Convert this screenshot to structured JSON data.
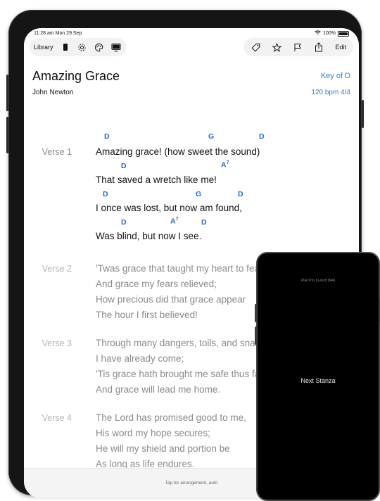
{
  "status": {
    "time": "11:28 am  Mon 29 Sep",
    "battery": "100%"
  },
  "toolbar": {
    "library_label": "Library",
    "edit_label": "Edit"
  },
  "song": {
    "title": "Amazing Grace",
    "author": "John Newton",
    "key": "Key of D",
    "tempo": "120 bpm   4/4"
  },
  "verses": [
    {
      "label": "Verse 1",
      "lines": [
        "Amazing grace! (how sweet the sound)",
        "That saved a wretch like me!",
        "I once was lost, but now am found,",
        "Was blind, but now I see."
      ],
      "chords": [
        [
          "D",
          "G",
          "D"
        ],
        [
          "D",
          "A7"
        ],
        [
          "D",
          "G",
          "D"
        ],
        [
          "D",
          "A7",
          "D"
        ]
      ]
    },
    {
      "label": "Verse 2",
      "lines": [
        "'Twas grace that taught my heart to fear,",
        "And grace my fears relieved;",
        "How precious did that grace appear",
        "The hour I first believed!"
      ]
    },
    {
      "label": "Verse 3",
      "lines": [
        "Through many dangers, toils, and snares,",
        "I have already come;",
        "'Tis grace hath brought me safe thus far,",
        "And grace will lead me home."
      ]
    },
    {
      "label": "Verse 4",
      "lines": [
        "The Lord has promised good to me,",
        "His word my hope secures;",
        "He will my shield and portion be",
        "As long as life endures."
      ]
    }
  ],
  "footer": {
    "hint": "Tap for arrangement, auto"
  },
  "phone": {
    "model": "iPad Pro 11-inch (M4)",
    "action": "Next Stanza"
  },
  "colors": {
    "chord": "#1e6ad8",
    "accent": "#2f7fd0"
  }
}
